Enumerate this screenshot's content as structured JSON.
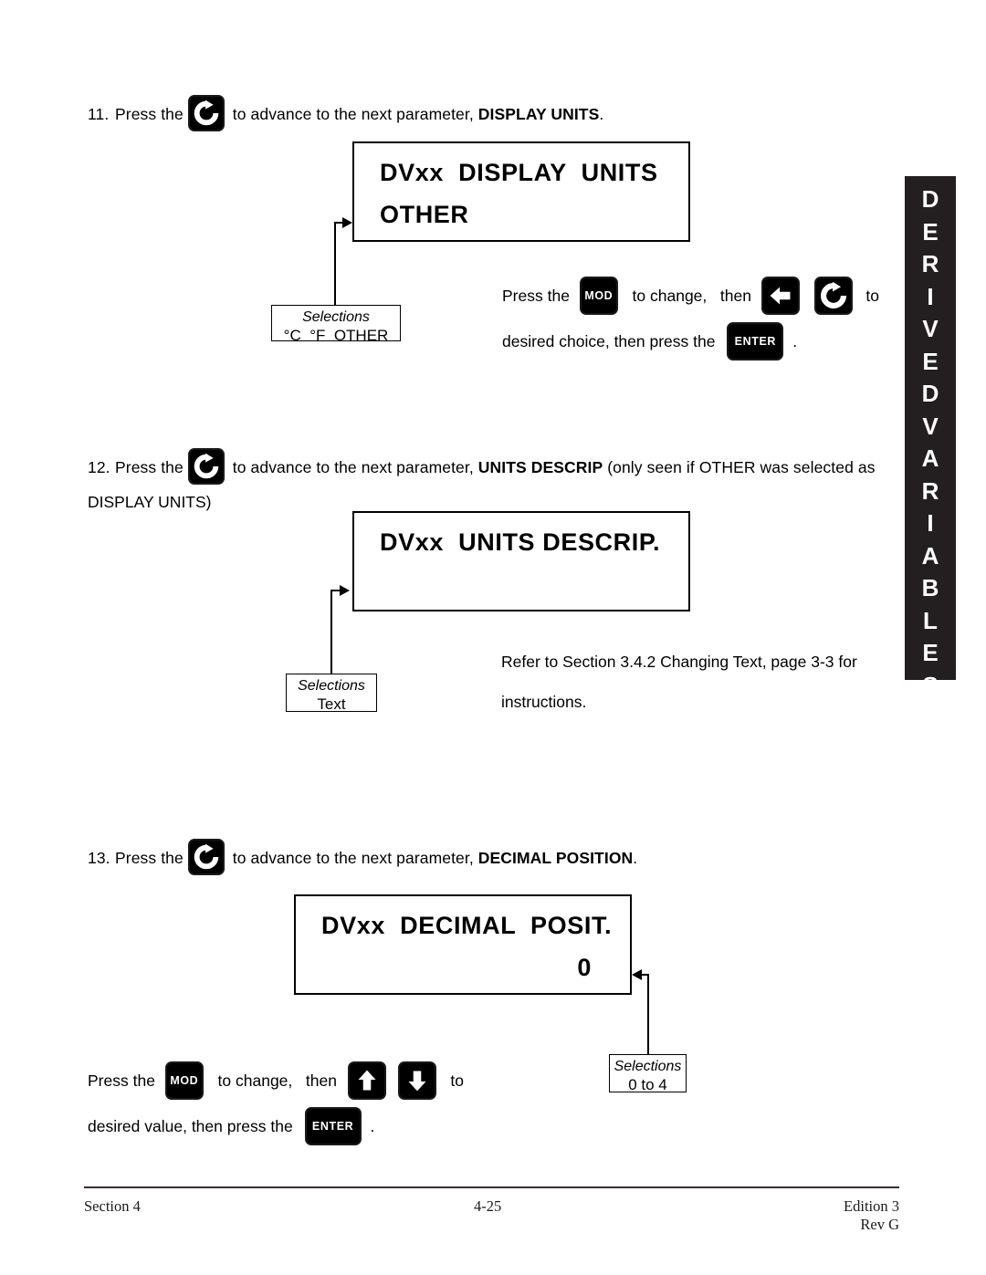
{
  "page": {
    "number": "4-25",
    "section_label": "Section 4",
    "edition": "Edition 3",
    "revision": "Rev  G"
  },
  "side_tab": {
    "text": "DERIVED VARIABLES",
    "word1": "DERIVED",
    "word2": "VARIABLES",
    "background": "#231f20",
    "color": "#ffffff"
  },
  "steps": [
    {
      "number": "11.",
      "before_icon": "Press the",
      "icon": "advance-circular-arrow-icon",
      "after_icon": " to advance to the next parameter, ",
      "parameter": "DISPLAY UNITS",
      "trailing": ".",
      "continuation": ""
    },
    {
      "number": "12.",
      "before_icon": "Press the",
      "icon": "advance-circular-arrow-icon",
      "after_icon": " to advance to the next parameter, ",
      "parameter": "UNITS DESCRIP",
      "trailing": " (only seen if OTHER was selected as",
      "continuation": "DISPLAY UNITS)"
    },
    {
      "number": "13.",
      "before_icon": "Press the",
      "icon": "advance-circular-arrow-icon",
      "after_icon": " to advance to the next parameter, ",
      "parameter": "DECIMAL POSITION",
      "trailing": ".",
      "continuation": ""
    }
  ],
  "displays": [
    {
      "id": "display-units",
      "line1": "DVxx  DISPLAY  UNITS",
      "line2": "OTHER",
      "line2_align": "left"
    },
    {
      "id": "units-descrip",
      "line1": "DVxx  UNITS DESCRIP.",
      "line2": "",
      "line2_align": "left"
    },
    {
      "id": "decimal-posit",
      "line1": "DVxx  DECIMAL  POSIT.",
      "line2": "0",
      "line2_align": "right"
    }
  ],
  "selections": [
    {
      "id": "selections-display-units",
      "title": "Selections",
      "value": "°C  °F  OTHER"
    },
    {
      "id": "selections-units-descrip",
      "title": "Selections",
      "value": "Text"
    },
    {
      "id": "selections-decimal-posit",
      "title": "Selections",
      "value": "0 to 4"
    }
  ],
  "instructions": {
    "display_units": {
      "seg1": "Press the",
      "mod_label": "MOD",
      "seg2": " to change,   then",
      "left_icon": "left-arrow-icon",
      "advance_icon": "advance-circular-arrow-icon",
      "seg3": " to",
      "line2_seg1": "desired choice, then press the",
      "enter_label": "ENTER",
      "line2_seg2": "."
    },
    "units_descrip": {
      "line1": "Refer to Section 3.4.2 Changing Text, page 3-3 for",
      "line2": "instructions."
    },
    "decimal_posit": {
      "seg1": "Press the",
      "mod_label": "MOD",
      "seg2": " to change,   then",
      "up_icon": "up-arrow-icon",
      "down_icon": "down-arrow-icon",
      "seg3": " to",
      "line2_seg1": "desired value, then press the",
      "enter_label": "ENTER",
      "line2_seg2": "."
    }
  }
}
